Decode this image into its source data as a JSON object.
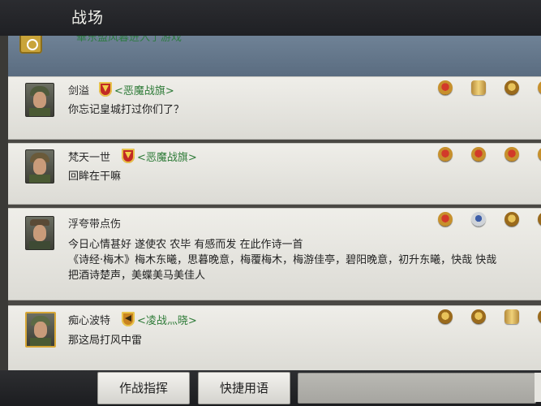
{
  "header": {
    "title": "战场"
  },
  "system_message": {
    "text": "華东盟风暮进入了游戏"
  },
  "messages": [
    {
      "name": "剑溢",
      "guild": "<恶魔战旗>",
      "lines": [
        "你忘记皇城打过你们了？"
      ]
    },
    {
      "name": "梵天一世",
      "guild": "<恶魔战旗>",
      "lines": [
        "回眸在干嘛"
      ]
    },
    {
      "name": "浮夸带点伤",
      "guild": "",
      "lines": [
        "今日心情甚好 遂使农 农毕 有感而发 在此作诗一首",
        "《诗经·梅木》梅木东曦，思暮晚意，梅覆梅木，梅游佳亭，碧阳晚意，初升东曦，快哉 快哉",
        "把酒诗楚声，美蝶美马美佳人"
      ]
    },
    {
      "name": "痴心波特",
      "guild": "<凌战灬晓>",
      "lines": [
        "那这局打风中雷"
      ]
    }
  ],
  "footer": {
    "command_button": "作战指挥",
    "quick_phrase_button": "快捷用语",
    "input_value": ""
  }
}
